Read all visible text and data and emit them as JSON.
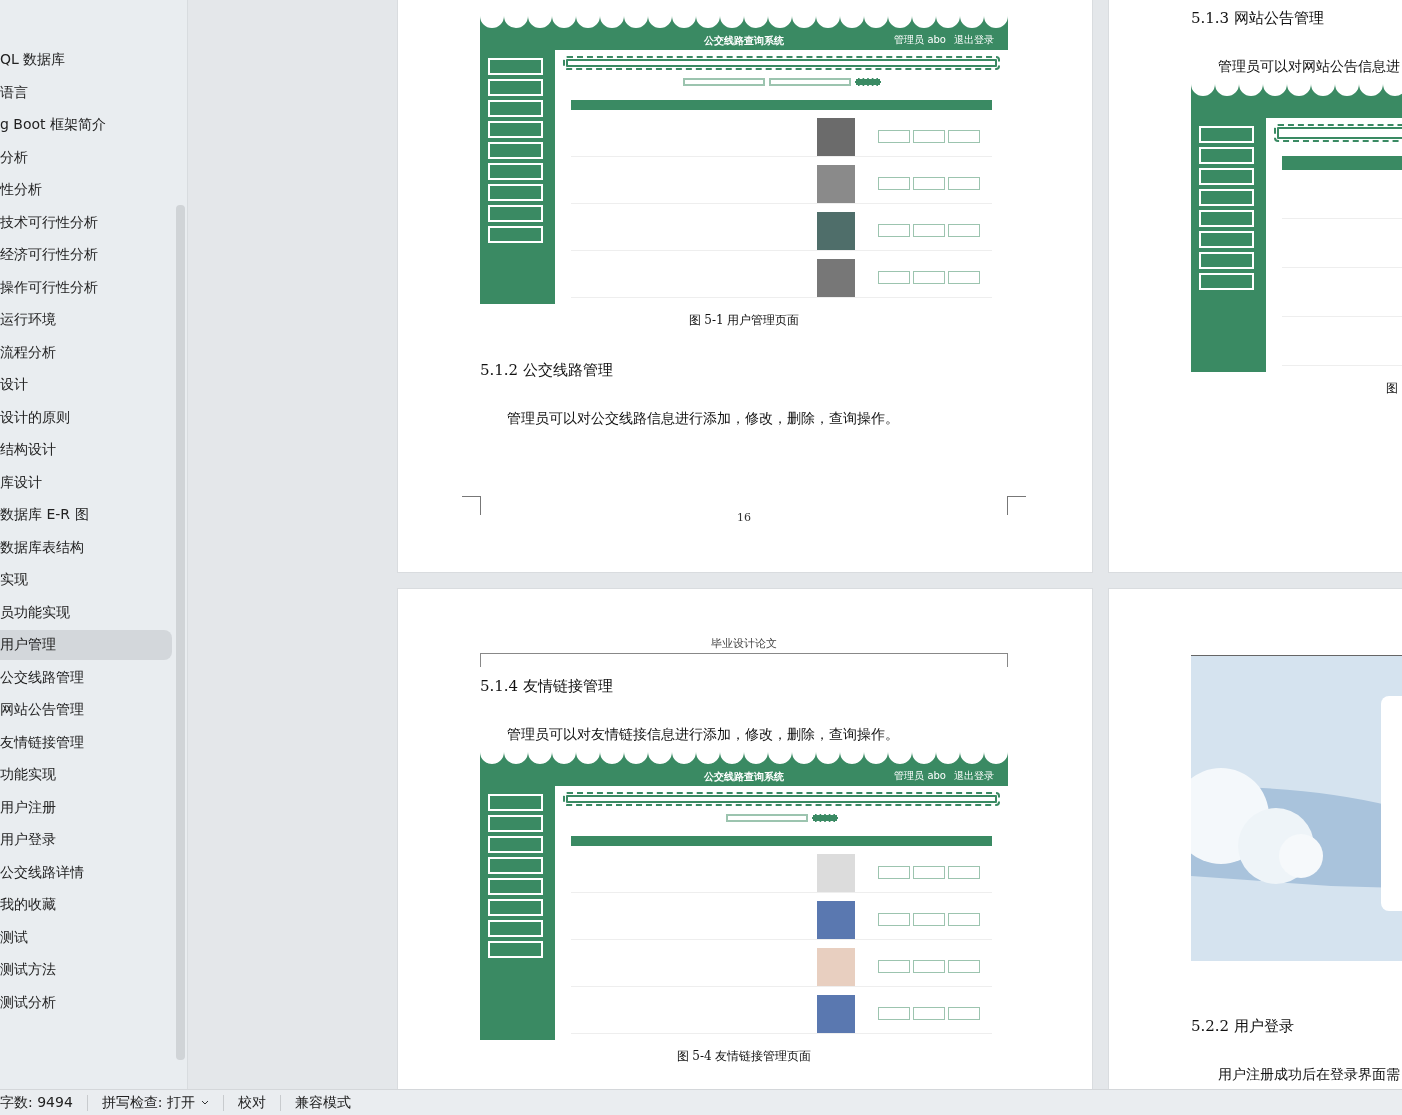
{
  "sidebar": {
    "items": [
      {
        "label": "QL 数据库",
        "selected": false
      },
      {
        "label": "语言",
        "selected": false
      },
      {
        "label": "g Boot 框架简介",
        "selected": false
      },
      {
        "label": "分析",
        "selected": false
      },
      {
        "label": "性分析",
        "selected": false
      },
      {
        "label": "技术可行性分析",
        "selected": false
      },
      {
        "label": "经济可行性分析",
        "selected": false
      },
      {
        "label": "操作可行性分析",
        "selected": false
      },
      {
        "label": "运行环境",
        "selected": false
      },
      {
        "label": "流程分析",
        "selected": false
      },
      {
        "label": "设计",
        "selected": false
      },
      {
        "label": "设计的原则",
        "selected": false
      },
      {
        "label": "结构设计",
        "selected": false
      },
      {
        "label": "库设计",
        "selected": false
      },
      {
        "label": "数据库 E-R 图",
        "selected": false
      },
      {
        "label": "数据库表结构",
        "selected": false
      },
      {
        "label": "实现",
        "selected": false
      },
      {
        "label": "员功能实现",
        "selected": false
      },
      {
        "label": "用户管理",
        "selected": true
      },
      {
        "label": "公交线路管理",
        "selected": false
      },
      {
        "label": "网站公告管理",
        "selected": false
      },
      {
        "label": "友情链接管理",
        "selected": false
      },
      {
        "label": "功能实现",
        "selected": false
      },
      {
        "label": "用户注册",
        "selected": false
      },
      {
        "label": "用户登录",
        "selected": false
      },
      {
        "label": "公交线路详情",
        "selected": false
      },
      {
        "label": "我的收藏",
        "selected": false
      },
      {
        "label": "测试",
        "selected": false
      },
      {
        "label": "测试方法",
        "selected": false
      },
      {
        "label": "测试分析",
        "selected": false
      }
    ]
  },
  "pages": [
    {
      "blocks": [
        {
          "kind": "figure",
          "figure": {
            "kind": "user_table",
            "title": "公交线路查询系统",
            "user": "管理员 abo",
            "logout": "退出登录"
          }
        },
        {
          "kind": "caption",
          "text": "图 5-1 用户管理页面"
        },
        {
          "kind": "heading",
          "text": "5.1.2 公交线路管理"
        },
        {
          "kind": "paragraph",
          "text": "管理员可以对公交线路信息进行添加，修改，删除，查询操作。"
        },
        {
          "kind": "footer",
          "text": "16"
        }
      ]
    },
    {
      "blocks": [
        {
          "kind": "heading",
          "text": "5.1.3 网站公告管理"
        },
        {
          "kind": "paragraph",
          "text": "管理员可以对网站公告信息进"
        },
        {
          "kind": "figure",
          "figure": {
            "kind": "notice_table"
          }
        },
        {
          "kind": "caption",
          "text": "图"
        }
      ]
    },
    {
      "blocks": [
        {
          "kind": "header",
          "text": "毕业设计论文"
        },
        {
          "kind": "heading",
          "text": "5.1.4 友情链接管理"
        },
        {
          "kind": "paragraph",
          "text": "管理员可以对友情链接信息进行添加，修改，删除，查询操作。"
        },
        {
          "kind": "figure",
          "figure": {
            "kind": "link_table",
            "title": "公交线路查询系统",
            "user": "管理员 abo",
            "logout": "退出登录"
          }
        },
        {
          "kind": "caption",
          "text": "图 5-4 友情链接管理页面"
        }
      ]
    },
    {
      "blocks": [
        {
          "kind": "figure",
          "figure": {
            "kind": "login_page"
          }
        },
        {
          "kind": "heading",
          "text": "5.2.2 用户登录"
        },
        {
          "kind": "paragraph",
          "text": "用户注册成功后在登录界面需"
        }
      ]
    }
  ],
  "status_bar": {
    "word_count": "字数: 9494",
    "spell_check": "拼写检查: 打开",
    "proofread": "校对",
    "compat_mode": "兼容模式"
  }
}
